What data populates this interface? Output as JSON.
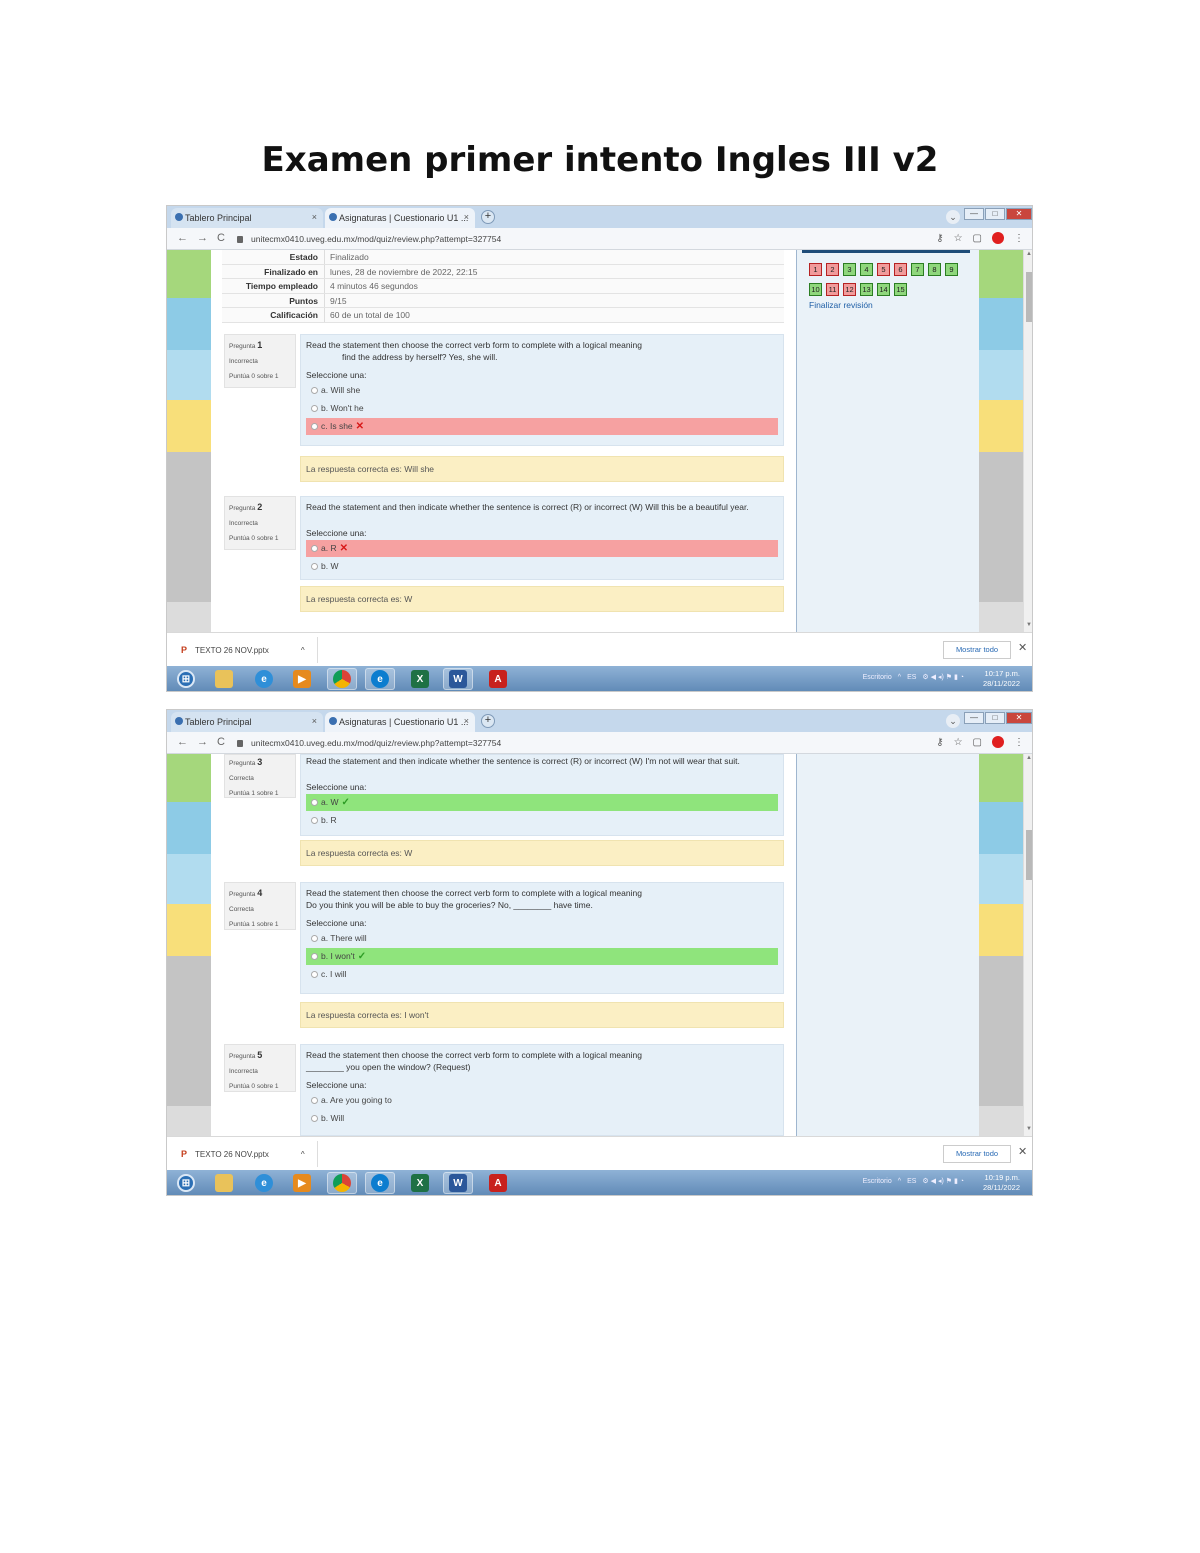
{
  "document": {
    "title": "Examen primer intento Ingles III v2"
  },
  "browser": {
    "tab_inactive": "Tablero Principal",
    "tab_active": "Asignaturas | Cuestionario U1 ...",
    "tab_close": "×",
    "new_tab": "+",
    "url": "unitecmx0410.uveg.edu.mx/mod/quiz/review.php?attempt=327754",
    "back": "←",
    "forward": "→",
    "reload": "C",
    "dropdown": "⌄",
    "min": "—",
    "max": "□",
    "close": "✕"
  },
  "summary": [
    {
      "label": "Estado",
      "value": "Finalizado"
    },
    {
      "label": "Finalizado en",
      "value": "lunes, 28 de noviembre de 2022, 22:15"
    },
    {
      "label": "Tiempo empleado",
      "value": "4 minutos 46 segundos"
    },
    {
      "label": "Puntos",
      "value": "9/15"
    },
    {
      "label": "Calificación",
      "value": "60 de un total de 100"
    }
  ],
  "nav": {
    "row1": [
      "1",
      "2",
      "3",
      "4",
      "5",
      "6",
      "7",
      "8",
      "9"
    ],
    "row1_status": [
      "bad",
      "bad",
      "ok",
      "ok",
      "bad",
      "bad",
      "ok",
      "ok",
      "ok"
    ],
    "row2": [
      "10",
      "11",
      "12",
      "13",
      "14",
      "15"
    ],
    "row2_status": [
      "ok",
      "bad",
      "bad",
      "ok",
      "ok",
      "ok"
    ],
    "finish": "Finalizar revisión"
  },
  "questions": {
    "q1": {
      "label": "Pregunta",
      "num": "1",
      "status": "Incorrecta",
      "points": "Puntúa 0 sobre 1",
      "text": "Read the statement then choose the correct verb form to complete with a logical meaning",
      "text2": "find the address by herself? Yes, she will.",
      "select": "Seleccione una:",
      "options": [
        "a. Will she",
        "b. Won't he",
        "c. Is she"
      ],
      "answer": "La respuesta correcta es: Will she"
    },
    "q2": {
      "label": "Pregunta",
      "num": "2",
      "status": "Incorrecta",
      "points": "Puntúa 0 sobre 1",
      "text": "Read the statement and then indicate whether the sentence is correct (R) or incorrect (W) Will this be a beautiful year.",
      "select": "Seleccione una:",
      "options": [
        "a. R",
        "b. W"
      ],
      "answer": "La respuesta correcta es: W"
    },
    "q3": {
      "label": "Pregunta",
      "num": "3",
      "status": "Correcta",
      "points": "Puntúa 1 sobre 1",
      "text": "Read the statement and then indicate whether the sentence is correct (R) or incorrect (W) I'm not will wear that suit.",
      "select": "Seleccione una:",
      "options": [
        "a. W",
        "b. R"
      ],
      "answer": "La respuesta correcta es: W"
    },
    "q4": {
      "label": "Pregunta",
      "num": "4",
      "status": "Correcta",
      "points": "Puntúa 1 sobre 1",
      "text": "Read the statement then choose the correct verb form to complete with a logical meaning",
      "text2": "Do you think you will be able to buy the groceries? No, ________ have time.",
      "select": "Seleccione una:",
      "options": [
        "a. There will",
        "b. I won't",
        "c. I will"
      ],
      "answer": "La respuesta correcta es: I won't"
    },
    "q5": {
      "label": "Pregunta",
      "num": "5",
      "status": "Incorrecta",
      "points": "Puntúa 0 sobre 1",
      "text": "Read the statement then choose the correct verb form to complete with a logical meaning",
      "text2": "________ you open the window? (Request)",
      "select": "Seleccione una:",
      "options": [
        "a. Are you going to",
        "b. Will"
      ]
    }
  },
  "downloads": {
    "file": "TEXTO 26 NOV.pptx",
    "chevron": "^",
    "show_all": "Mostrar todo",
    "close": "✕"
  },
  "taskbar": {
    "lang": "ES",
    "search": "Escritorio",
    "time1": "10:17 p.m.",
    "time2": "10:19 p.m.",
    "date": "28/11/2022"
  },
  "colors": {
    "correct": "#8fe47c",
    "incorrect": "#f6a1a1",
    "answer_bg": "#fbefc4",
    "question_bg": "#e6f0f8"
  }
}
